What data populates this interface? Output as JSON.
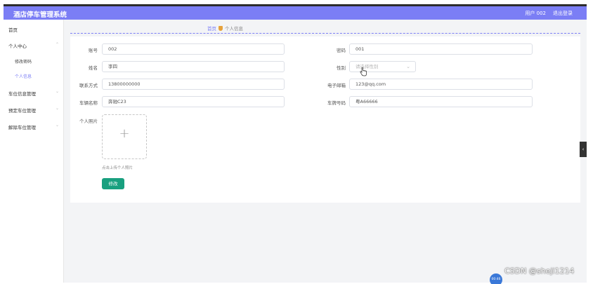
{
  "header": {
    "title": "酒店停车管理系统",
    "user": "用户 002",
    "logout": "退出登录"
  },
  "sidebar": {
    "home": "首页",
    "personal_center": "个人中心",
    "change_password": "修改密码",
    "personal_info": "个人信息",
    "parking_info": "车位信息管理",
    "reserve_parking": "预定车位管理",
    "release_parking": "解除车位管理"
  },
  "breadcrumb": {
    "home": "首页",
    "current": "个人信息"
  },
  "form": {
    "account_label": "账号",
    "account_value": "002",
    "password_label": "密码",
    "password_value": "001",
    "name_label": "姓名",
    "name_value": "李四",
    "gender_label": "性别",
    "gender_placeholder": "请选择性别",
    "contact_label": "联系方式",
    "contact_value": "13800000000",
    "email_label": "电子邮箱",
    "email_value": "123@qq.com",
    "vehicle_label": "车辆名称",
    "vehicle_value": "奔驰C23",
    "plate_label": "车牌号码",
    "plate_value": "粤A66666",
    "photo_label": "个人照片",
    "upload_tip": "点击上传个人照片",
    "submit": "修改"
  },
  "misc": {
    "side_tab": "‹",
    "badge": "00:46",
    "watermark": "CSDN @sheji1214"
  },
  "colors": {
    "header": "#7b7ef5",
    "accent": "#7b7ef5",
    "button": "#19a07f"
  }
}
